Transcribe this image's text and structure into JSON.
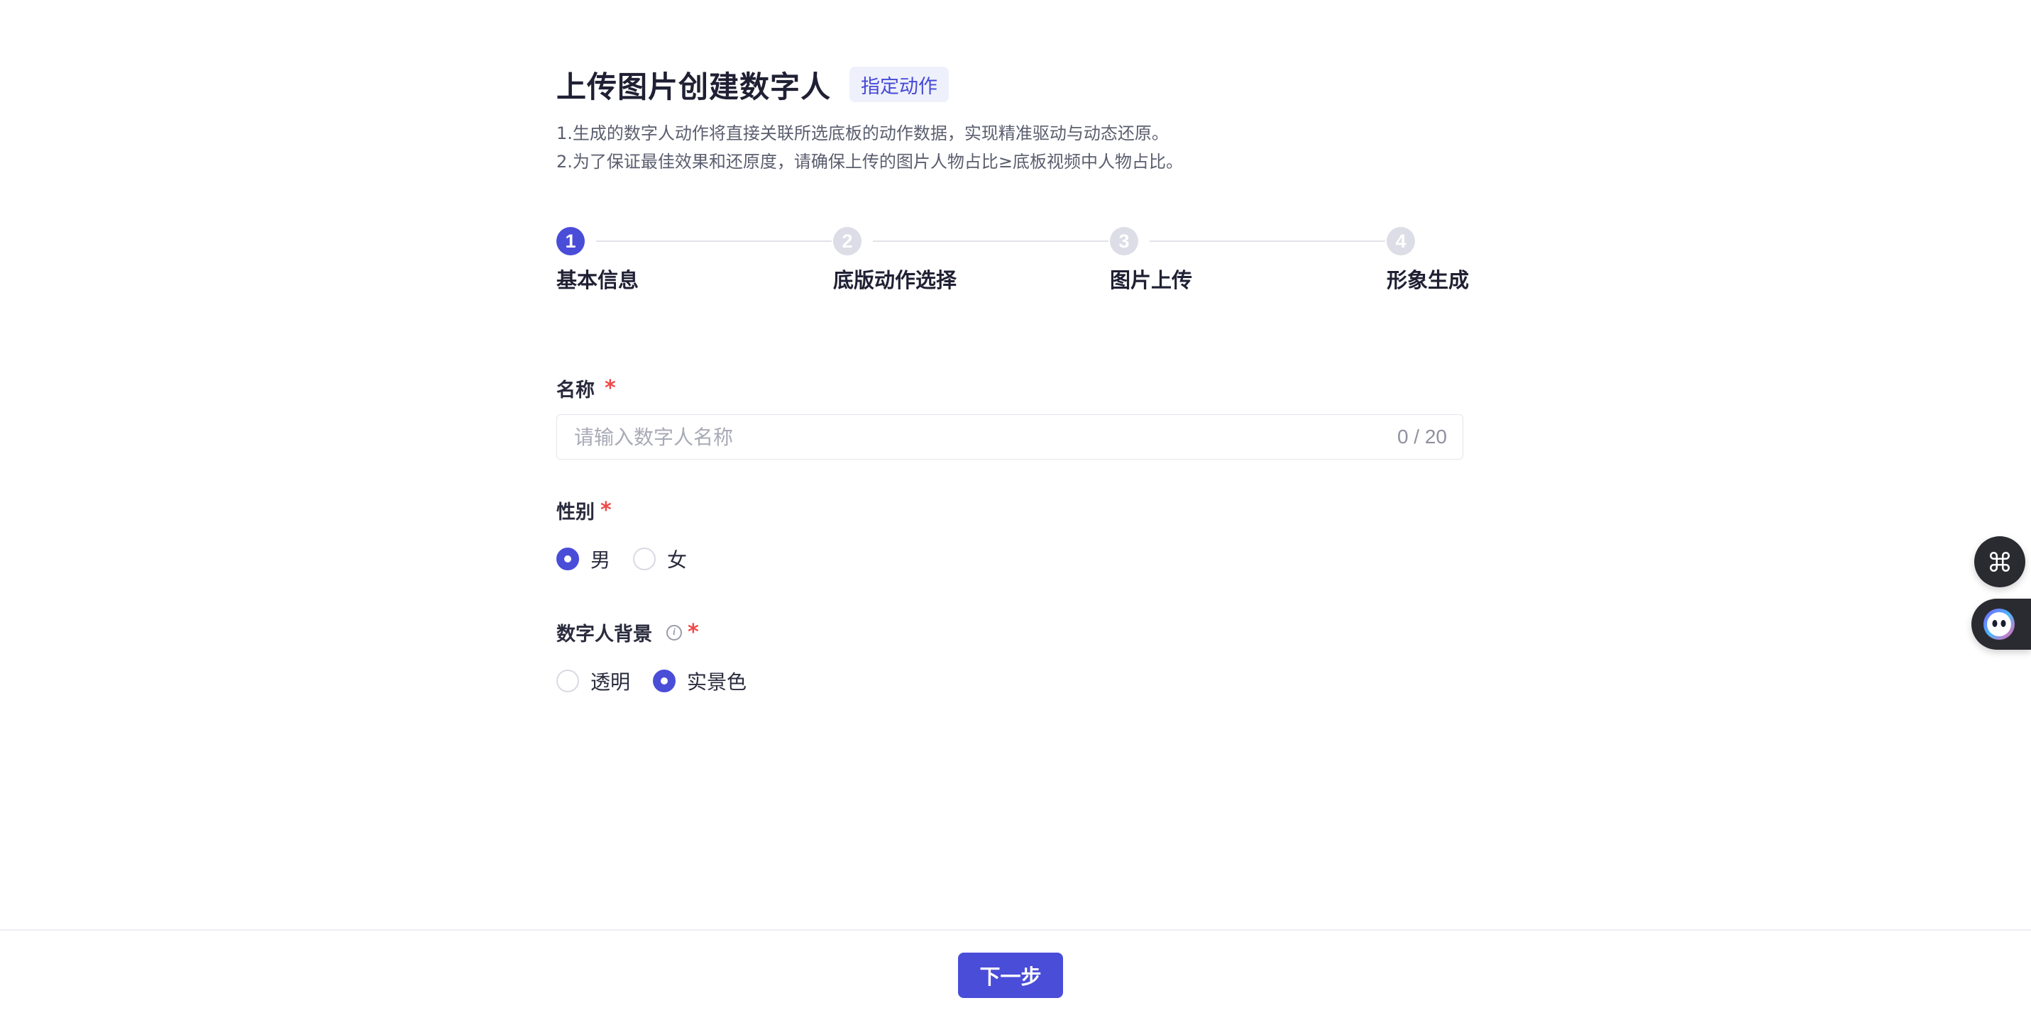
{
  "header": {
    "title": "上传图片创建数字人",
    "tag": "指定动作",
    "desc_lines": [
      "1.生成的数字人动作将直接关联所选底板的动作数据，实现精准驱动与动态还原。",
      "2.为了保证最佳效果和还原度，请确保上传的图片人物占比≥底板视频中人物占比。"
    ]
  },
  "steps": [
    {
      "number": "1",
      "label": "基本信息",
      "state": "active"
    },
    {
      "number": "2",
      "label": "底版动作选择",
      "state": "pending"
    },
    {
      "number": "3",
      "label": "图片上传",
      "state": "pending"
    },
    {
      "number": "4",
      "label": "形象生成",
      "state": "pending"
    }
  ],
  "form": {
    "name": {
      "label": "名称",
      "required_mark": "*",
      "placeholder": "请输入数字人名称",
      "value": "",
      "counter": "0 / 20"
    },
    "gender": {
      "label": "性别",
      "required_mark": "*",
      "options": [
        {
          "label": "男",
          "checked": true
        },
        {
          "label": "女",
          "checked": false
        }
      ]
    },
    "background": {
      "label": "数字人背景",
      "info_icon": "info-icon",
      "required_mark": "*",
      "options": [
        {
          "label": "透明",
          "checked": false
        },
        {
          "label": "实景色",
          "checked": true
        }
      ]
    }
  },
  "footer": {
    "next_label": "下一步"
  },
  "floating": {
    "command_icon": "command-icon",
    "assistant_icon": "assistant-bot-icon"
  },
  "colors": {
    "accent": "#4a4dd8",
    "required": "#f04848",
    "tag_bg": "#eef0fb"
  }
}
